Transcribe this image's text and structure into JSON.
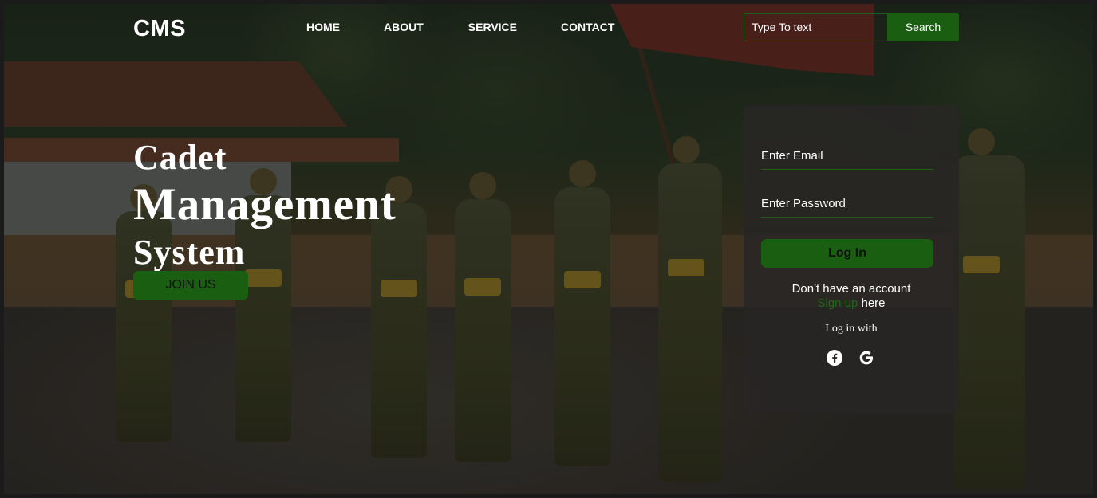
{
  "brand": {
    "logo": "CMS"
  },
  "nav": {
    "items": [
      "HOME",
      "ABOUT",
      "SERVICE",
      "CONTACT"
    ]
  },
  "search": {
    "placeholder": "Type To text",
    "button_label": "Search"
  },
  "hero": {
    "line1": "Cadet",
    "line2": "Management",
    "line3": "System",
    "join_label": "JOIN US"
  },
  "login": {
    "email_placeholder": "Enter Email",
    "password_placeholder": "Enter Password",
    "button_label": "Log In",
    "no_account_text": "Don't have an account",
    "signup_label": "Sign up",
    "signup_suffix": "here",
    "login_with": "Log in with",
    "social_icons": [
      "facebook-icon",
      "google-icon"
    ]
  },
  "colors": {
    "accent_green": "#1a5e12",
    "link_green": "#1d6a14",
    "card_bg": "#282624",
    "text": "#ffffff"
  }
}
